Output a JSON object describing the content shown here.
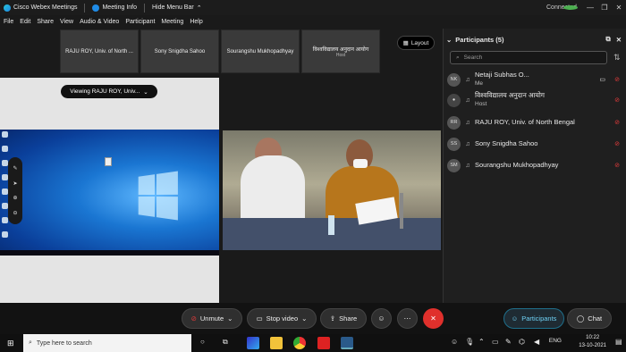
{
  "window": {
    "app_title": "Cisco Webex Meetings",
    "meeting_info": "Meeting Info",
    "hide_menu_bar": "Hide Menu Bar",
    "status": "Connected"
  },
  "menu": [
    "File",
    "Edit",
    "Share",
    "View",
    "Audio & Video",
    "Participant",
    "Meeting",
    "Help"
  ],
  "thumbnails": [
    {
      "name": "RAJU ROY, Univ. of North ...",
      "host": ""
    },
    {
      "name": "Sony Snigdha Sahoo",
      "host": ""
    },
    {
      "name": "Sourangshu Mukhopadhyay",
      "host": ""
    },
    {
      "name": "विश्वविद्यालय अनुदान आयोग",
      "host": "Host"
    }
  ],
  "layout_label": "Layout",
  "viewing_label": "Viewing RAJU ROY, Univ...",
  "panel": {
    "title": "Participants (5)",
    "search_placeholder": "Search",
    "participants": [
      {
        "initials": "NK",
        "name": "Netaji Subhas O...",
        "sub": "Me"
      },
      {
        "initials": "",
        "name": "विश्वविद्यालय अनुदान आयोग",
        "sub": "Host"
      },
      {
        "initials": "RR",
        "name": "RAJU ROY, Univ. of North Bengal",
        "sub": ""
      },
      {
        "initials": "SS",
        "name": "Sony Snigdha Sahoo",
        "sub": ""
      },
      {
        "initials": "SM",
        "name": "Sourangshu Mukhopadhyay",
        "sub": ""
      }
    ]
  },
  "controls": {
    "unmute": "Unmute",
    "stop_video": "Stop video",
    "share": "Share",
    "participants": "Participants",
    "chat": "Chat"
  },
  "taskbar": {
    "search_placeholder": "Type here to search",
    "lang": "ENG",
    "time": "10:22",
    "date": "13-10-2021"
  }
}
